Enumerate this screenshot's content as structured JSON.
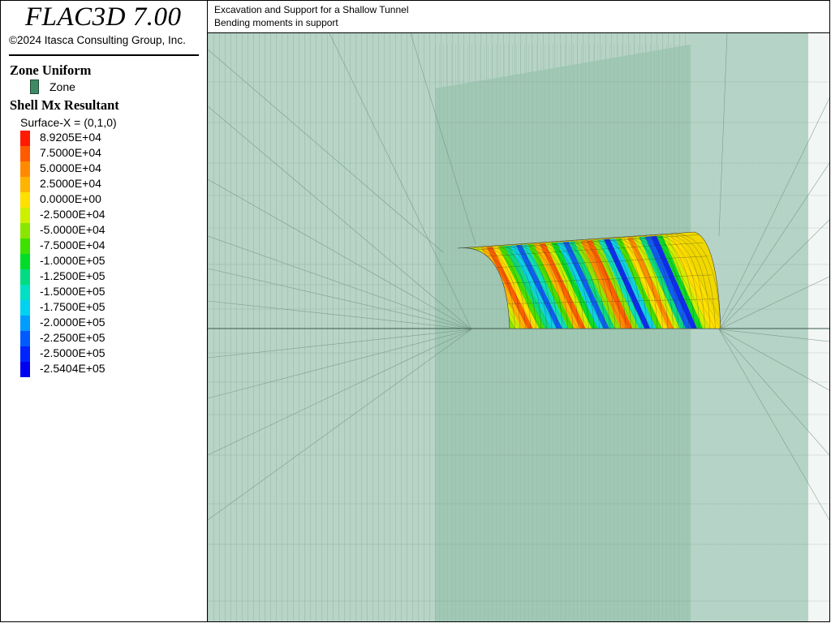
{
  "app": {
    "title": "FLAC3D 7.00",
    "copyright": "©2024 Itasca Consulting Group, Inc."
  },
  "plot": {
    "title_line1": "Excavation and Support for a Shallow Tunnel",
    "title_line2": "Bending moments in support"
  },
  "legend": {
    "zone_section": "Zone Uniform",
    "zone_label": "Zone",
    "zone_color": "#3f8a66",
    "shell_section": "Shell Mx Resultant",
    "surface": "Surface-X = (0,1,0)",
    "contours": [
      {
        "label": "8.9205E+04",
        "color": "#ff1a00"
      },
      {
        "label": "7.5000E+04",
        "color": "#ff5a00"
      },
      {
        "label": "5.0000E+04",
        "color": "#ff8a00"
      },
      {
        "label": "2.5000E+04",
        "color": "#ffb400"
      },
      {
        "label": "0.0000E+00",
        "color": "#ffe000"
      },
      {
        "label": "-2.5000E+04",
        "color": "#ccf000"
      },
      {
        "label": "-5.0000E+04",
        "color": "#8ae600"
      },
      {
        "label": "-7.5000E+04",
        "color": "#3ee000"
      },
      {
        "label": "-1.0000E+05",
        "color": "#00dc28"
      },
      {
        "label": "-1.2500E+05",
        "color": "#00dc82"
      },
      {
        "label": "-1.5000E+05",
        "color": "#00e0c2"
      },
      {
        "label": "-1.7500E+05",
        "color": "#00d2f0"
      },
      {
        "label": "-2.0000E+05",
        "color": "#009cff"
      },
      {
        "label": "-2.2500E+05",
        "color": "#005aff"
      },
      {
        "label": "-2.5000E+05",
        "color": "#0024ff"
      },
      {
        "label": "-2.5404E+05",
        "color": "#0000f0"
      }
    ]
  }
}
